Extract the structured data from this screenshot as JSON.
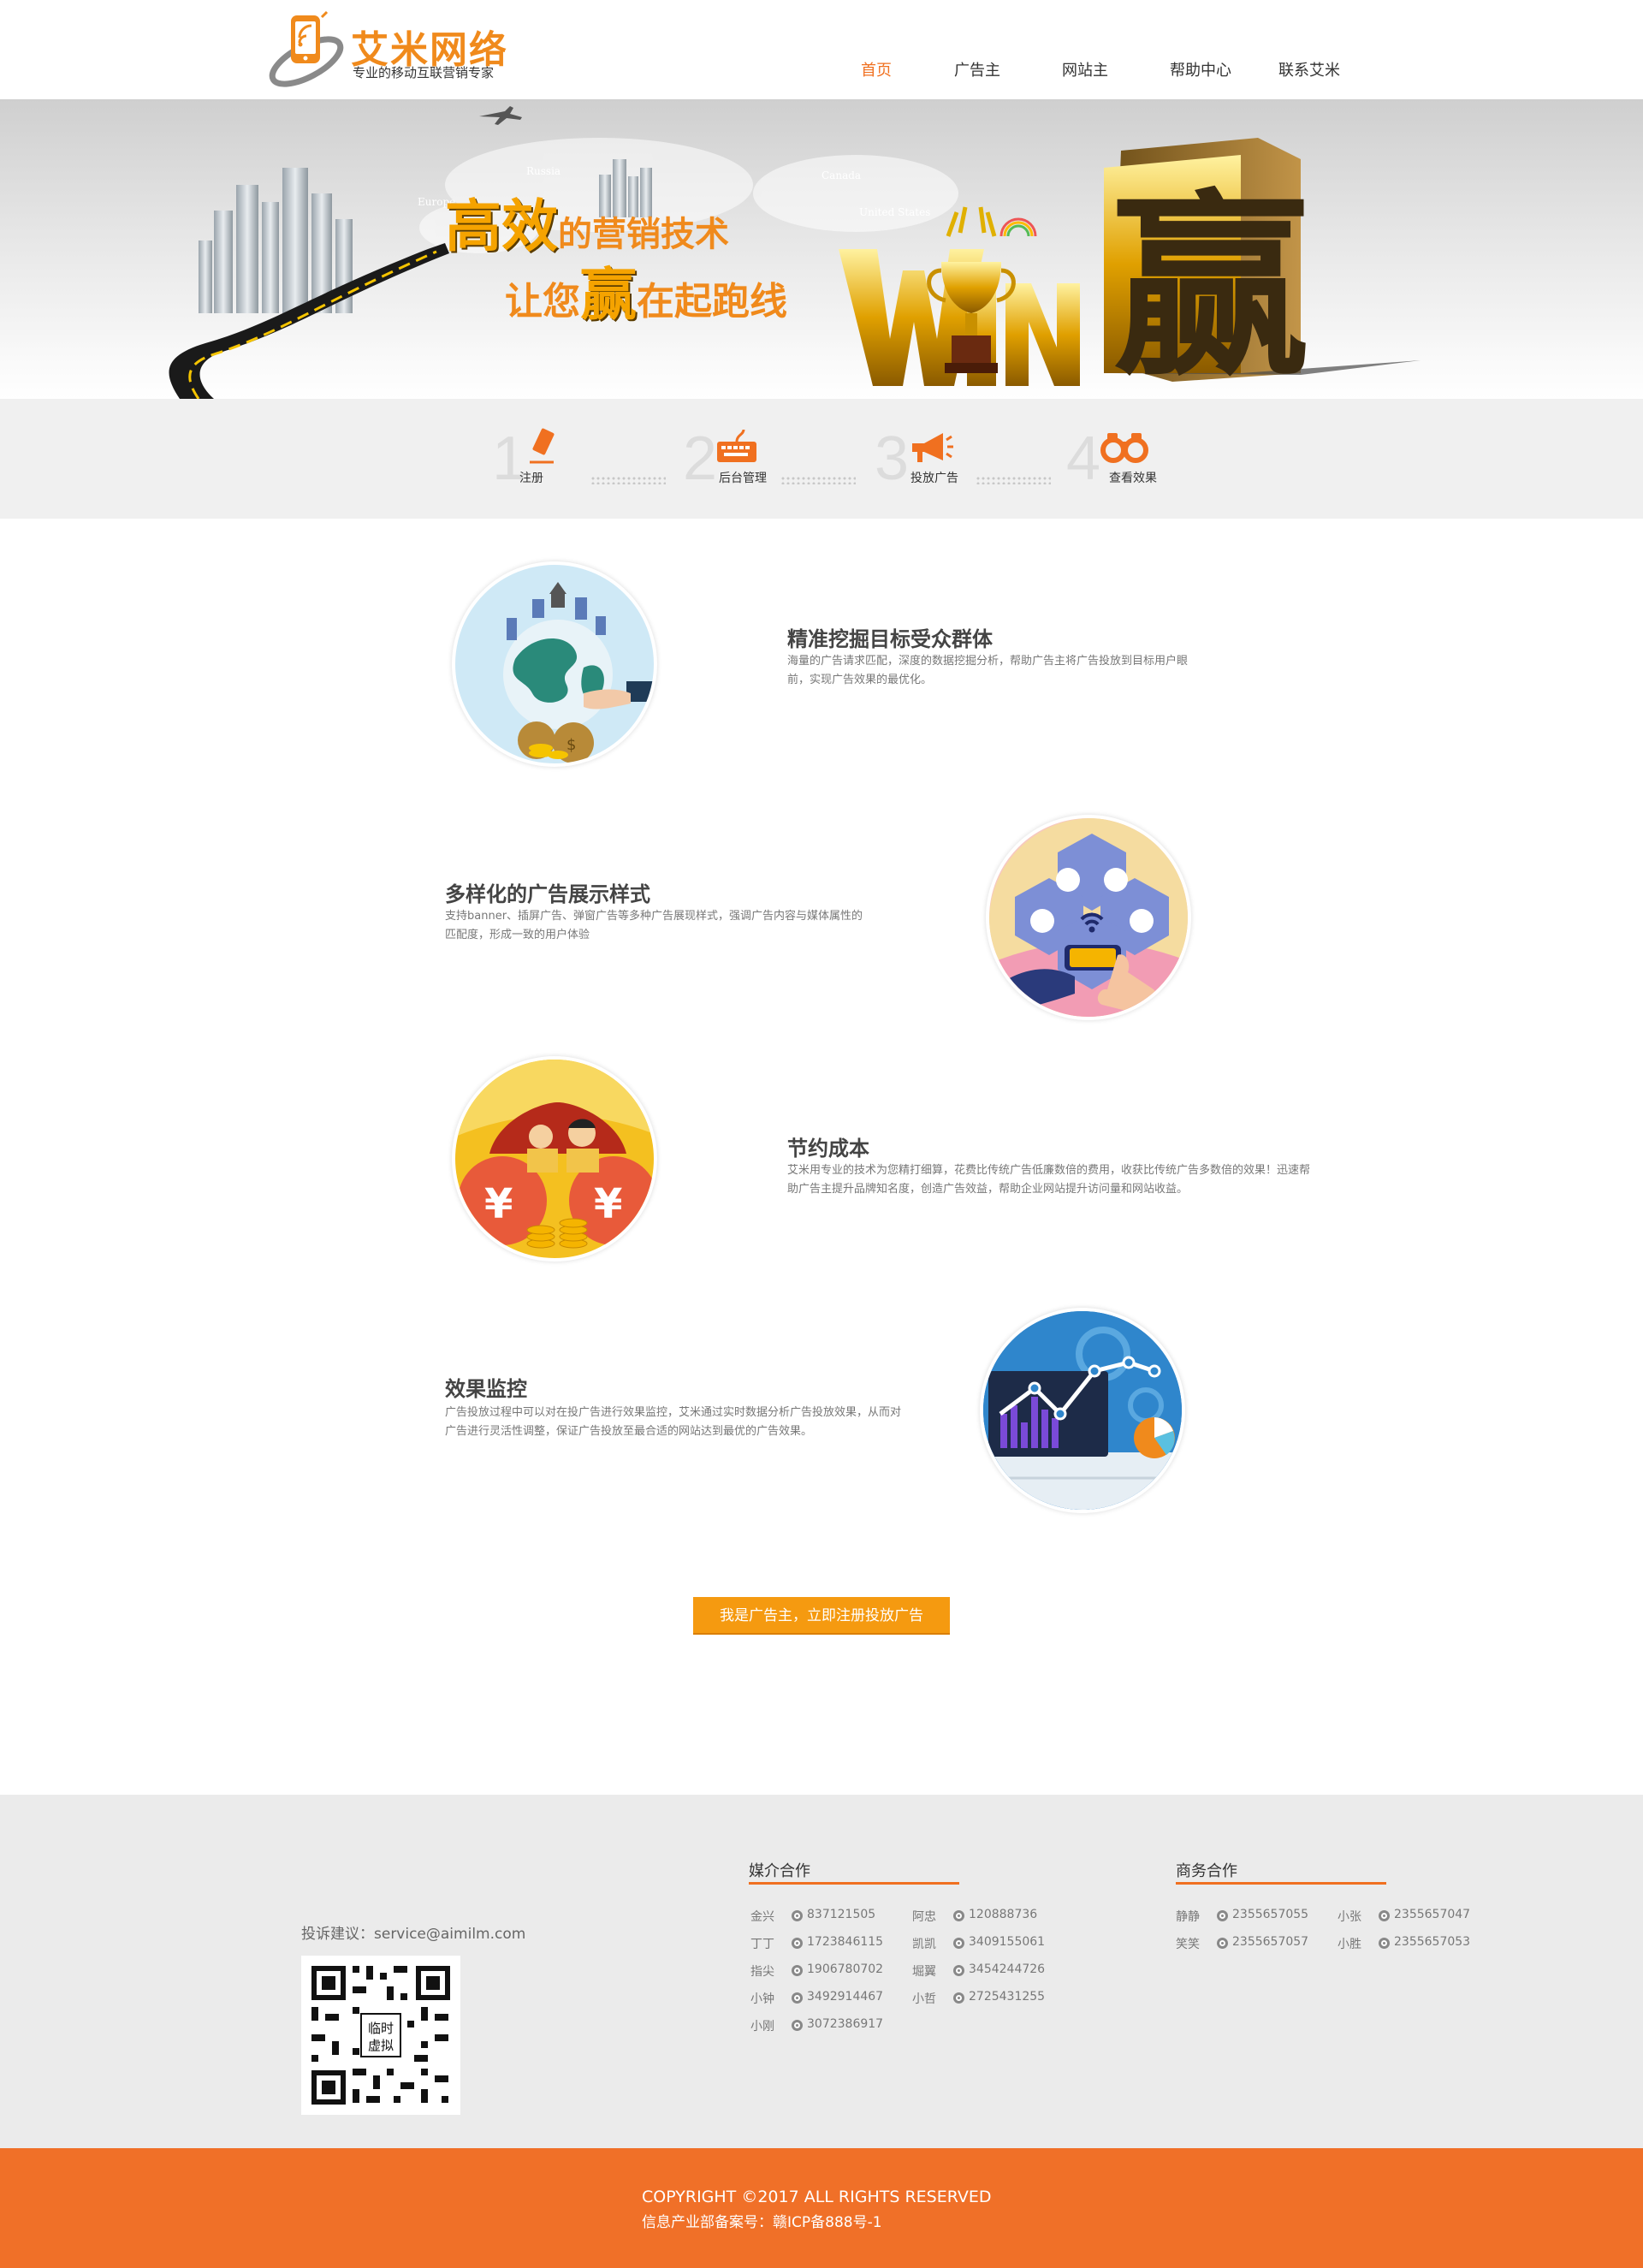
{
  "brand": {
    "name": "艾米网络",
    "slogan": "专业的移动互联营销专家",
    "accent_color": "#f07020"
  },
  "nav": {
    "items": [
      {
        "label": "首页",
        "active": true
      },
      {
        "label": "广告主",
        "active": false
      },
      {
        "label": "网站主",
        "active": false
      },
      {
        "label": "帮助中心",
        "active": false
      },
      {
        "label": "联系艾米",
        "active": false
      }
    ]
  },
  "banner": {
    "line1": {
      "big": "高效",
      "rest": "的营销技术"
    },
    "line2": {
      "pre": "让您",
      "big": "赢",
      "post": "在起跑线"
    },
    "win_text": "WIN",
    "win_char": "赢",
    "map_labels": [
      "Russia",
      "Europe",
      "Canada",
      "United States"
    ]
  },
  "steps": [
    {
      "num": "1",
      "label": "注册",
      "icon": "pencil-icon"
    },
    {
      "num": "2",
      "label": "后台管理",
      "icon": "keyboard-icon"
    },
    {
      "num": "3",
      "label": "投放广告",
      "icon": "megaphone-icon"
    },
    {
      "num": "4",
      "label": "查看效果",
      "icon": "binoculars-icon"
    }
  ],
  "features": [
    {
      "title": "精准挖掘目标受众群体",
      "desc": "海量的广告请求匹配，深度的数据挖掘分析，帮助广告主将广告投放到目标用户眼前，实现广告效果的最优化。",
      "icon": "globe-money-icon"
    },
    {
      "title": "多样化的广告展示样式",
      "desc": "支持banner、插屏广告、弹窗广告等多种广告展现样式，强调广告内容与媒体属性的匹配度，形成一致的用户体验",
      "icon": "hexagon-touch-icon"
    },
    {
      "title": "节约成本",
      "desc": "艾米用专业的技术为您精打细算，花费比传统广告低廉数倍的费用，收获比传统广告多数倍的效果！迅速帮助广告主提升品牌知名度，创造广告效益，帮助企业网站提升访问量和网站收益。",
      "icon": "money-bags-icon"
    },
    {
      "title": "效果监控",
      "desc": "广告投放过程中可以对在投广告进行效果监控，艾米通过实时数据分析广告投放效果，从而对广告进行灵活性调整，保证广告投放至最合适的网站达到最优的广告效果。",
      "icon": "analytics-chart-icon"
    }
  ],
  "cta": {
    "label": "我是广告主，立即注册投放广告"
  },
  "footer": {
    "complaint": "投诉建议：service@aimilm.com",
    "qr_label": [
      "临时",
      "虚拟"
    ],
    "media": {
      "title": "媒介合作",
      "left": [
        {
          "name": "金兴",
          "qq": "837121505"
        },
        {
          "name": "丁丁",
          "qq": "1723846115"
        },
        {
          "name": "指尖",
          "qq": "1906780702"
        },
        {
          "name": "小钟",
          "qq": "3492914467"
        },
        {
          "name": "小刚",
          "qq": "3072386917"
        }
      ],
      "right": [
        {
          "name": "阿忠",
          "qq": "120888736"
        },
        {
          "name": "凯凯",
          "qq": "3409155061"
        },
        {
          "name": "堀翼",
          "qq": "3454244726"
        },
        {
          "name": "小哲",
          "qq": "2725431255"
        }
      ]
    },
    "business": {
      "title": "商务合作",
      "left": [
        {
          "name": "静静",
          "qq": "2355657055"
        },
        {
          "name": "笑笑",
          "qq": "2355657057"
        }
      ],
      "right": [
        {
          "name": "小张",
          "qq": "2355657047"
        },
        {
          "name": "小胜",
          "qq": "2355657053"
        }
      ]
    }
  },
  "copyright": {
    "line1": "COPYRIGHT ©2017 ALL RIGHTS RESERVED",
    "line2": "信息产业部备案号：赣ICP备888号-1"
  }
}
